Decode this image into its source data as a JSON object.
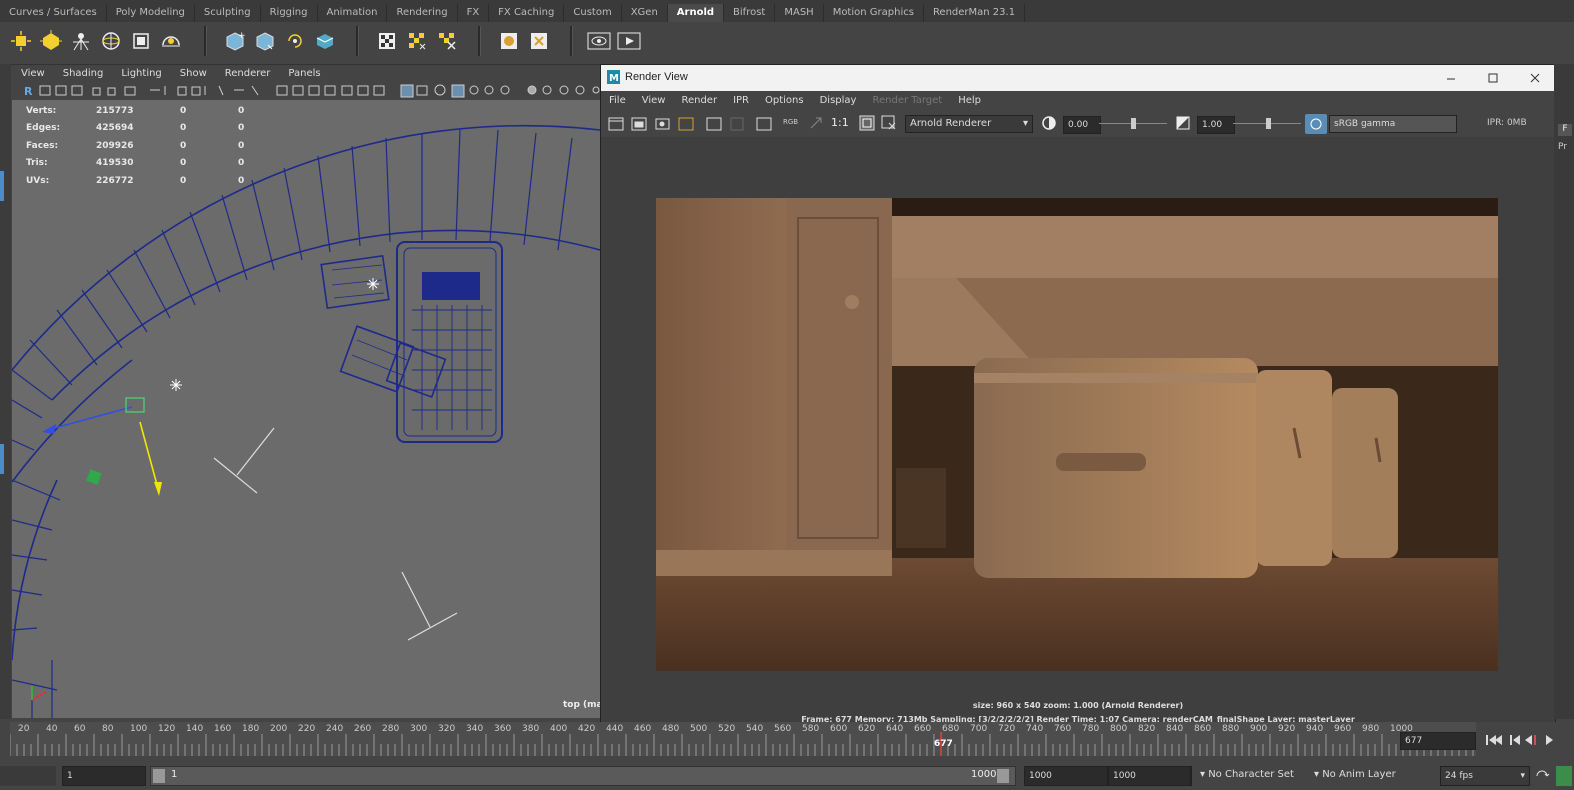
{
  "shelf_tabs": [
    "Curves / Surfaces",
    "Poly Modeling",
    "Sculpting",
    "Rigging",
    "Animation",
    "Rendering",
    "FX",
    "FX Caching",
    "Custom",
    "XGen",
    "Arnold",
    "Bifrost",
    "MASH",
    "Motion Graphics",
    "RenderMan 23.1"
  ],
  "active_tab": "Arnold",
  "viewport": {
    "menu": [
      "View",
      "Shading",
      "Lighting",
      "Show",
      "Renderer",
      "Panels"
    ],
    "camera_label": "top (mas",
    "hud": [
      {
        "label": "Verts:",
        "v1": "215773",
        "v2": "0",
        "v3": "0"
      },
      {
        "label": "Edges:",
        "v1": "425694",
        "v2": "0",
        "v3": "0"
      },
      {
        "label": "Faces:",
        "v1": "209926",
        "v2": "0",
        "v3": "0"
      },
      {
        "label": "Tris:",
        "v1": "419530",
        "v2": "0",
        "v3": "0"
      },
      {
        "label": "UVs:",
        "v1": "226772",
        "v2": "0",
        "v3": "0"
      }
    ]
  },
  "render_view": {
    "title": "Render View",
    "menu": [
      "File",
      "View",
      "Render",
      "IPR",
      "Options",
      "Display",
      "Render Target",
      "Help"
    ],
    "disabled_menu": "Render Target",
    "toolbar": {
      "one_to_one": "1:1",
      "renderer": "Arnold Renderer",
      "exposure": "0.00",
      "gamma": "1.00",
      "view_transform": "sRGB gamma",
      "ipr_memory": "IPR: 0MB",
      "rgb_label": "RGB"
    },
    "status_line1": "size: 960 x 540  zoom: 1.000     (Arnold Renderer)",
    "status_line2": "Frame: 677     Memory: 713Mb     Sampling: [3/2/2/2/2/2]     Render Time: 1:07     Camera: renderCAM_finalShape     Layer: masterLayer"
  },
  "right_strip": {
    "a": "F",
    "b": "Pr"
  },
  "timeline": {
    "ticks": [
      "20",
      "40",
      "60",
      "80",
      "100",
      "120",
      "140",
      "160",
      "180",
      "200",
      "220",
      "240",
      "260",
      "280",
      "300",
      "320",
      "340",
      "360",
      "380",
      "400",
      "420",
      "440",
      "460",
      "480",
      "500",
      "520",
      "540",
      "560",
      "580",
      "600",
      "620",
      "640",
      "660",
      "680",
      "700",
      "720",
      "740",
      "760",
      "780",
      "800",
      "820",
      "840",
      "860",
      "880",
      "900",
      "920",
      "940",
      "960",
      "980",
      "1000"
    ],
    "current_frame_label": "677",
    "current_frame_field": "677"
  },
  "range": {
    "start": "1",
    "slider_start": "1",
    "slider_end": "1000",
    "end": "1000",
    "anim_end": "1000",
    "character_set": "No Character Set",
    "anim_layer": "No Anim Layer",
    "fps": "24 fps"
  },
  "colors": {
    "accent_tab": "#4a4a4a",
    "wire": "#2a2a8a",
    "render_bg": "#3f3f3f"
  }
}
